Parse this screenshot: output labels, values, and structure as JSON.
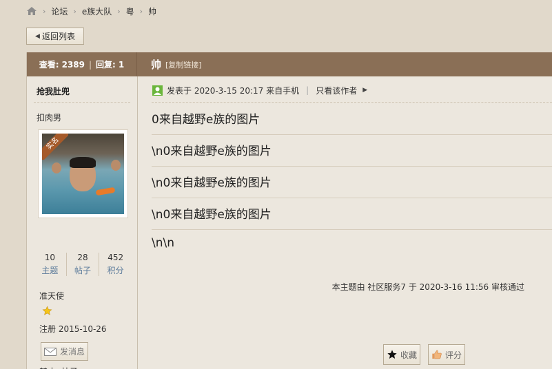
{
  "breadcrumb": {
    "items": [
      "论坛",
      "e族大队",
      "粤",
      "帅"
    ]
  },
  "back_button": {
    "label": "返回列表"
  },
  "side_header": {
    "views_label": "查看:",
    "views": "2389",
    "replies_label": "回复:",
    "replies": "1"
  },
  "thread": {
    "title": "帅",
    "copy_link": "[复制链接]"
  },
  "author": {
    "name": "抢我肚兜",
    "group": "扣肉男",
    "ribbon": "实名",
    "stats": [
      {
        "num": "10",
        "label": "主题"
      },
      {
        "num": "28",
        "label": "帖子"
      },
      {
        "num": "452",
        "label": "积分"
      }
    ],
    "rank": "准天使",
    "register": "注册  2015-10-26",
    "message_button": "发消息",
    "ban": "禁止",
    "posts": "帖子"
  },
  "post": {
    "meta_text": "发表于 2020-3-15 20:17 来自手机",
    "only_author": "只看该作者",
    "lines": [
      "0来自越野e族的图片",
      "\\n0来自越野e族的图片",
      "\\n0来自越野e族的图片",
      "\\n0来自越野e族的图片",
      "\\n\\n"
    ],
    "review_note": "本主题由 社区服务7 于 2020-3-16 11:56 审核通过",
    "favorite_button": "收藏",
    "rate_button": "评分"
  },
  "colors": {
    "background": "#e1d9cb",
    "header_brown": "#8a6f56",
    "panel": "#ece7de"
  }
}
